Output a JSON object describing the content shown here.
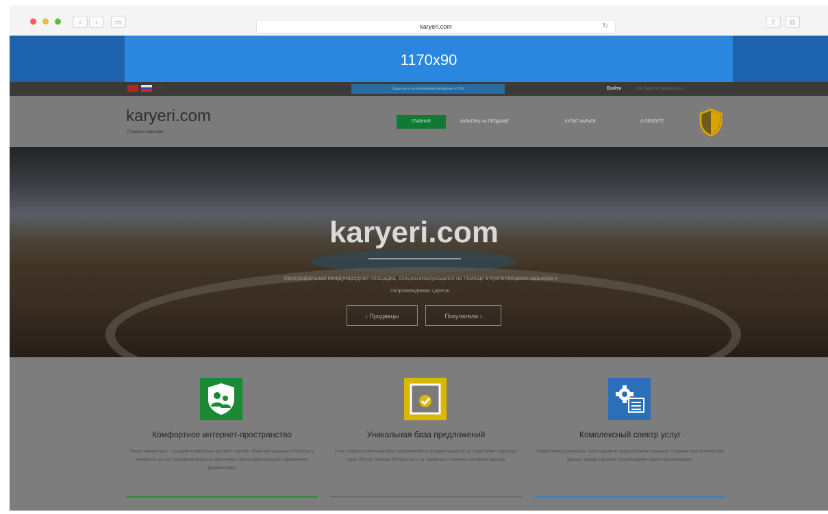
{
  "browser": {
    "url": "karyeri.com",
    "back_glyph": "‹",
    "forward_glyph": "›",
    "sidebar_glyph": "▭",
    "reload_glyph": "↻",
    "share_glyph": "⇧",
    "tabs_glyph": "⧉"
  },
  "ad_banner": {
    "label": "1170x90"
  },
  "topbar": {
    "lang_text": "ЭН",
    "notice": "Закрытая и полномочийная мезарения и НСК",
    "login": "Войти",
    "register": "или Зарегистрироваться"
  },
  "header": {
    "logo": "karyeri.com",
    "logo_sub": "Продажа карьеров",
    "nav": {
      "home": "ГЛАВНАЯ",
      "sale": "КАРЬЕРЫ НА ПРОДАЖЕ",
      "buy": "КУПИТ КАРЬЕР",
      "about": "О ПРОЕКТЕ"
    }
  },
  "hero": {
    "title": "karyeri.com",
    "description": "Узкопрофильная международная площадка, специализирующаяся на помощи в купле/продаже карьеров и сопровождении сделок.",
    "btn_sellers": "‹ Продавцы",
    "btn_buyers": "Покупатели ›"
  },
  "features": [
    {
      "title": "Комфортное интернет-пространство",
      "text": "Наша главная цель – создание комфортных условий торговли объектами карьерного бизнеса в интернете, за счет упрощения процесса заключения сделки купли-продажи, оформления документации.",
      "icon": "users-shield-icon"
    },
    {
      "title": "Уникальная база предложений",
      "text": "У нас собрана уникальная база предложений по продаже карьеров, на территории следующих стран: Россия, Украина, Белоруссия и тд. Гранитные, глиняные, песчаные карьеры.",
      "icon": "checkmark-box-icon"
    },
    {
      "title": "Комплексный спектр услуг",
      "text": "Оформление документов, поиск карьеров, моделирование карьеров, создание геологических баз данных, карьер под ключ, сопровождение сделки купли-продажи.",
      "icon": "gear-list-icon"
    }
  ],
  "colors": {
    "ad_outer": "#1d62ad",
    "ad_inner": "#2a86de",
    "nav_active": "#0e7a33",
    "icon_green": "#1a8a35",
    "icon_yellow": "#d9b800",
    "icon_blue": "#2a6fb8"
  }
}
